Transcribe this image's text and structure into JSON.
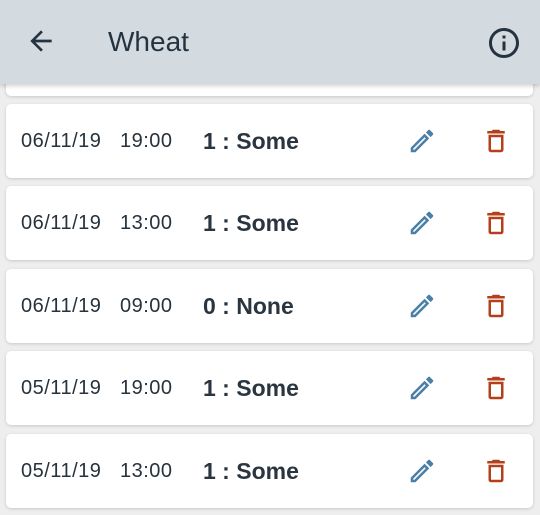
{
  "appbar": {
    "title": "Wheat",
    "back_icon": "arrow-left-icon",
    "info_icon": "info-circle-icon"
  },
  "colors": {
    "appbar_bg": "#d3dbe0",
    "edit_icon": "#4a7fa7",
    "delete_icon": "#b3401a"
  },
  "entries": [
    {
      "date": "06/11/19",
      "time": "19:00",
      "value": "1 : Some"
    },
    {
      "date": "06/11/19",
      "time": "13:00",
      "value": "1 : Some"
    },
    {
      "date": "06/11/19",
      "time": "09:00",
      "value": "0 : None"
    },
    {
      "date": "05/11/19",
      "time": "19:00",
      "value": "1 : Some"
    },
    {
      "date": "05/11/19",
      "time": "13:00",
      "value": "1 : Some"
    }
  ]
}
